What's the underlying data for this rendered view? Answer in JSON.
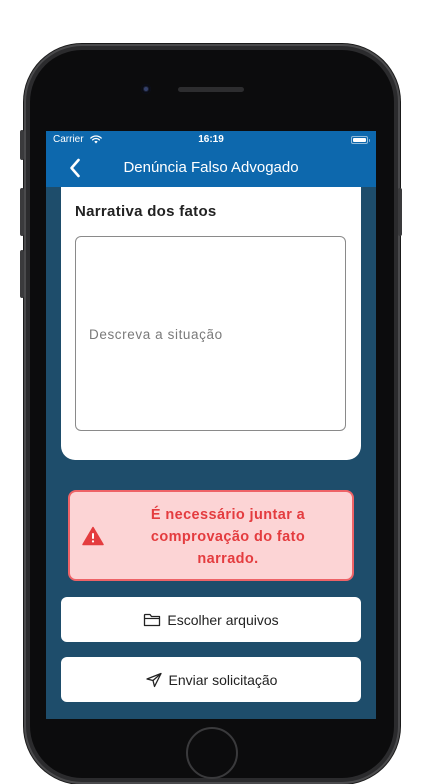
{
  "status_bar": {
    "carrier": "Carrier",
    "time": "16:19",
    "wifi_icon": "wifi-icon",
    "battery_icon": "battery-icon"
  },
  "nav": {
    "title": "Denúncia Falso Advogado",
    "back_icon": "chevron-left-icon"
  },
  "form": {
    "section_title": "Narrativa dos fatos",
    "narrative_placeholder": "Descreva a situação",
    "narrative_value": ""
  },
  "alert": {
    "icon": "warning-triangle-icon",
    "message": "É necessário juntar a comprovação do fato narrado.",
    "lines": [
      "É necessário juntar a",
      "comprovação do fato",
      "narrado."
    ]
  },
  "actions": {
    "choose_files_label": "Escolher arquivos",
    "choose_files_icon": "folder-icon",
    "send_label": "Enviar solicitação",
    "send_icon": "send-icon"
  },
  "colors": {
    "nav_bar": "#0d68ad",
    "screen_background": "#1e4d6b",
    "alert_background": "#fcd4d5",
    "alert_border": "#ee6367",
    "alert_text": "#e43c3f"
  }
}
